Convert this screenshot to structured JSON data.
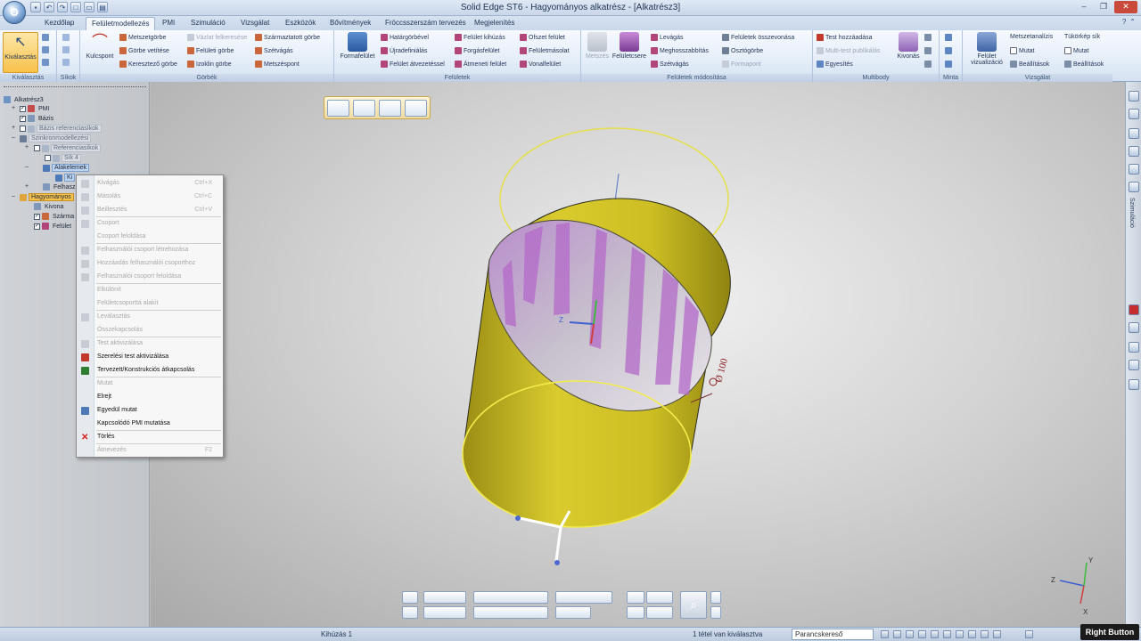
{
  "window": {
    "title": "Solid Edge ST6 - Hagyományos alkatrész - [Alkatrész3]",
    "qat_icons": [
      "save-icon",
      "undo-icon",
      "redo-icon",
      "new-icon",
      "open-icon",
      "print-icon"
    ]
  },
  "tabs": [
    "Kezdőlap",
    "Felületmodellezés",
    "PMI",
    "Szimuláció",
    "Vizsgálat",
    "Eszközök",
    "Bővítmények",
    "Fröccsszerszám tervezés",
    "Megjelenítés"
  ],
  "active_tab": "Felületmodellezés",
  "ribbon": {
    "kivalasztas": {
      "label": "Kiválasztás",
      "group": "Kiválasztás"
    },
    "sikok": {
      "group": "Síkok"
    },
    "gorbek": {
      "kulcspont": "Kulcspont",
      "col1": [
        "Metszetgörbe",
        "Görbe vetítése",
        "Keresztező görbe"
      ],
      "col2": [
        "Vázlat felkeresése",
        "Felületi görbe",
        "Izoklin görbe"
      ],
      "col3": [
        "Származtatott görbe",
        "Szétvágás",
        "Metszéspont"
      ],
      "group": "Görbék"
    },
    "feluletek": {
      "formafelulet": "Formafelület",
      "col1": [
        "Határgörbével",
        "Újradefiniálás",
        "Felület átvezetéssel"
      ],
      "col2": [
        "Felület kihúzás",
        "Forgásfelület",
        "Átmeneti felület"
      ],
      "col3": [
        "Ofszet felület",
        "Felületmásolat",
        "Vonalfelület"
      ],
      "group": "Felületek"
    },
    "felulet_modositasa": {
      "metszes": "Metszés",
      "feluletcsere": "Felületcsere",
      "col1": [
        "Levágás",
        "Meghosszabbítás",
        "Szétvágás"
      ],
      "col2": [
        "Felületek összevonása",
        "Osztógörbe",
        "Formapont"
      ],
      "group": "Felületek módosítása"
    },
    "multibody": {
      "items": [
        "Test hozzáadása",
        "Multi-test publikálás",
        "Egyesítés"
      ],
      "kivonas": "Kivonás",
      "group": "Multibody"
    },
    "minta": {
      "group": "Minta"
    },
    "vizsgalat": {
      "felulet_viz": "Felület vizualizáció",
      "metszetanalizis": "Metszetanalízis",
      "mutat1": "Mutat",
      "beallitasok1": "Beállítások",
      "tukorkep": "Tükörkép sík",
      "mutat2": "Mutat",
      "beallitasok2": "Beállítások",
      "group": "Vizsgálat"
    }
  },
  "tree": {
    "root": "Alkatrész3",
    "pmi": "PMI",
    "bazis": "Bázis",
    "bazis_ref": "Bázis referenciasíkok",
    "szinkron": "Szinkronmodellezési",
    "referenciasikok": "Referenciasíkok",
    "sik4": "Sík 4",
    "alakelemek": "Alakelemek",
    "kihuzas_short": "Ki",
    "felhasz": "Felhasz",
    "hagyomanyos": "Hagyományos",
    "kivonas": "Kivona",
    "szarmaz": "Szárma",
    "felulet": "Felület"
  },
  "context_menu": [
    {
      "label": "Kivágás",
      "shortcut": "Ctrl+X",
      "enabled": false,
      "icon": "cut-icon"
    },
    {
      "label": "Másolás",
      "shortcut": "Ctrl+C",
      "enabled": false,
      "icon": "copy-icon"
    },
    {
      "label": "Beillesztés",
      "shortcut": "Ctrl+V",
      "enabled": false,
      "icon": "paste-icon"
    },
    {
      "label": "Csoport",
      "shortcut": "",
      "enabled": false,
      "icon": "group-icon"
    },
    {
      "label": "Csoport feloldása",
      "shortcut": "",
      "enabled": false,
      "icon": ""
    },
    {
      "label": "Felhasználói csoport létrehozása",
      "shortcut": "",
      "enabled": false,
      "icon": "user-group-icon"
    },
    {
      "label": "Hozzáadás felhasználói csoporthoz",
      "shortcut": "",
      "enabled": false,
      "icon": "add-group-icon"
    },
    {
      "label": "Felhasználói csoport feloldása",
      "shortcut": "",
      "enabled": false,
      "icon": "ungroup-icon"
    },
    {
      "label": "Elkülönít",
      "shortcut": "",
      "enabled": false,
      "icon": ""
    },
    {
      "label": "Felületcsoporttá alakít",
      "shortcut": "",
      "enabled": false,
      "icon": ""
    },
    {
      "label": "Leválasztás",
      "shortcut": "",
      "enabled": false,
      "icon": "detach-icon"
    },
    {
      "label": "Összekapcsolás",
      "shortcut": "",
      "enabled": false,
      "icon": ""
    },
    {
      "label": "Test aktivizálása",
      "shortcut": "",
      "enabled": false,
      "icon": "body-activate-icon"
    },
    {
      "label": "Szerelési test aktivizálása",
      "shortcut": "",
      "enabled": true,
      "icon": "assembly-body-icon"
    },
    {
      "label": "Tervezett/Konstrukciós átkapcsolás",
      "shortcut": "",
      "enabled": true,
      "icon": "construction-toggle-icon"
    },
    {
      "label": "Mutat",
      "shortcut": "",
      "enabled": false,
      "icon": ""
    },
    {
      "label": "Elrejt",
      "shortcut": "",
      "enabled": true,
      "icon": ""
    },
    {
      "label": "Egyedül mutat",
      "shortcut": "",
      "enabled": true,
      "icon": "show-only-icon"
    },
    {
      "label": "Kapcsolódó PMI mutatása",
      "shortcut": "",
      "enabled": true,
      "icon": ""
    },
    {
      "label": "Törlés",
      "shortcut": "",
      "enabled": true,
      "icon": "delete-icon"
    },
    {
      "label": "Átnevezés",
      "shortcut": "F2",
      "enabled": false,
      "icon": ""
    }
  ],
  "viewport": {
    "dimension_label": "Ø 100",
    "axis_labels": {
      "z": "Z",
      "y": "Y",
      "x": "X"
    }
  },
  "rightbar": {
    "vertical_label": "Szimuláció"
  },
  "status": {
    "left": "Kihúzás 1",
    "mid": "1 tétel van kiválasztva",
    "command_finder": "Parancskereső",
    "right_button": "Right Button"
  },
  "colors": {
    "cylinder_fill": "#d4c62a",
    "cylinder_edge": "#f2e94a",
    "surface_purple": "#b780c8",
    "ribbon_selected": "#f7c14b",
    "delete_red": "#d42020"
  }
}
